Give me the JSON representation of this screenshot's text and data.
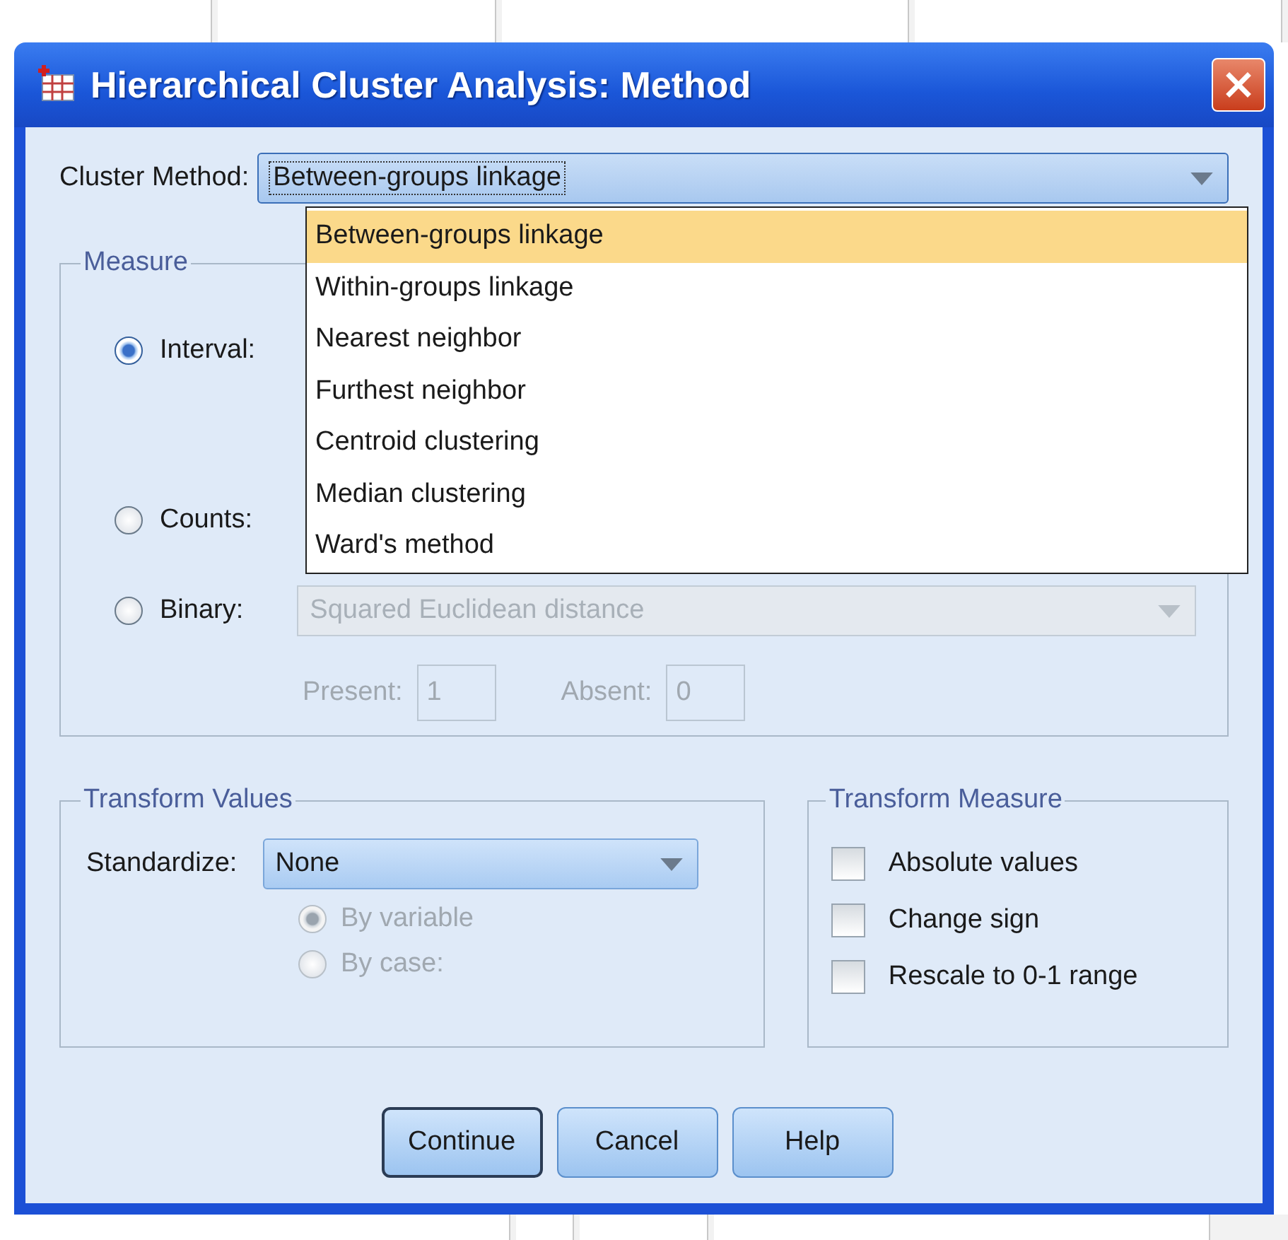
{
  "window": {
    "title": "Hierarchical Cluster Analysis: Method"
  },
  "cluster_method": {
    "label": "Cluster Method:",
    "value": "Between-groups linkage",
    "expanded": true,
    "options": [
      {
        "label": "Between-groups linkage",
        "selected": true
      },
      {
        "label": "Within-groups linkage",
        "selected": false
      },
      {
        "label": "Nearest neighbor",
        "selected": false
      },
      {
        "label": "Furthest neighbor",
        "selected": false
      },
      {
        "label": "Centroid clustering",
        "selected": false
      },
      {
        "label": "Median clustering",
        "selected": false
      },
      {
        "label": "Ward's method",
        "selected": false
      }
    ]
  },
  "measure": {
    "title": "Measure",
    "options": [
      {
        "label": "Interval:",
        "selected": true
      },
      {
        "label": "Counts:",
        "selected": false
      },
      {
        "label": "Binary:",
        "selected": false
      }
    ],
    "binary_measure": {
      "value": "Squared Euclidean distance",
      "disabled": true
    },
    "present": {
      "label": "Present:",
      "value": "1",
      "disabled": true
    },
    "absent": {
      "label": "Absent:",
      "value": "0",
      "disabled": true
    }
  },
  "transform_values": {
    "title": "Transform Values",
    "standardize": {
      "label": "Standardize:",
      "value": "None"
    },
    "by": [
      {
        "label": "By variable",
        "selected": true,
        "disabled": true
      },
      {
        "label": "By case:",
        "selected": false,
        "disabled": true
      }
    ]
  },
  "transform_measure": {
    "title": "Transform Measure",
    "options": [
      {
        "label": "Absolute values",
        "checked": false
      },
      {
        "label": "Change sign",
        "checked": false
      },
      {
        "label": "Rescale to 0-1 range",
        "checked": false
      }
    ]
  },
  "buttons": [
    {
      "label": "Continue",
      "default": true
    },
    {
      "label": "Cancel",
      "default": false
    },
    {
      "label": "Help",
      "default": false
    }
  ]
}
